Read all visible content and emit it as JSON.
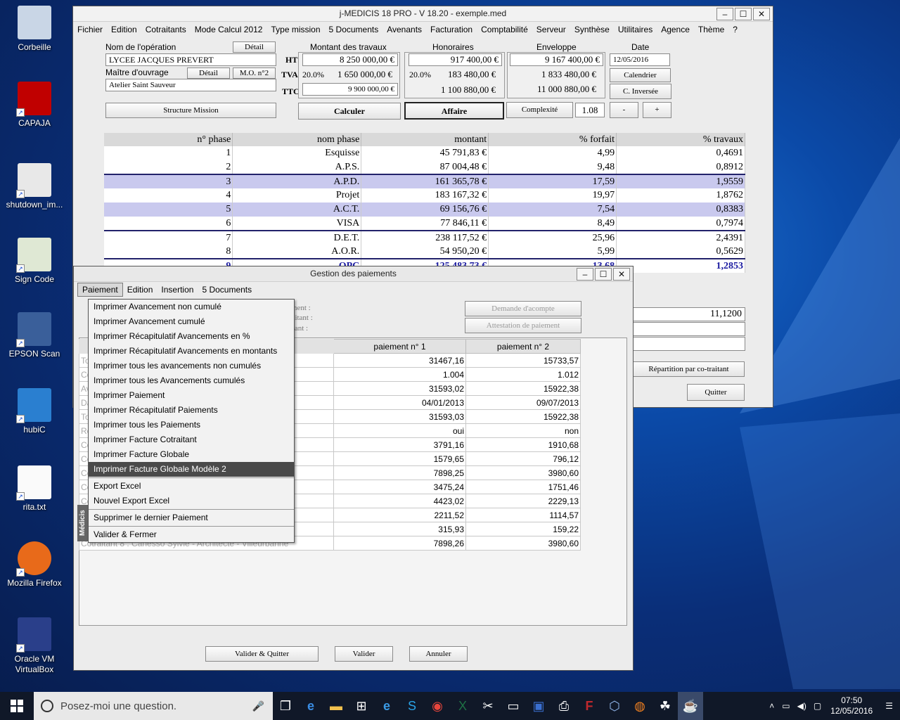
{
  "desktop": {
    "icons": [
      {
        "label": "Corbeille",
        "icon": "recycle-bin-icon"
      },
      {
        "label": "CAPAJA",
        "icon": "capaja-icon"
      },
      {
        "label": "shutdown_im...",
        "icon": "gear-file-icon"
      },
      {
        "label": "Sign Code",
        "icon": "certificate-icon"
      },
      {
        "label": "EPSON Scan",
        "icon": "scanner-icon"
      },
      {
        "label": "hubiC",
        "icon": "hubic-icon"
      },
      {
        "label": "rita.txt",
        "icon": "text-file-icon"
      },
      {
        "label": "Mozilla Firefox",
        "icon": "firefox-icon"
      },
      {
        "label": "Oracle VM VirtualBox",
        "icon": "virtualbox-icon"
      }
    ]
  },
  "main_window": {
    "title": "j-MEDICIS 18 PRO - V 18.20 - exemple.med",
    "menu": [
      "Fichier",
      "Edition",
      "Cotraitants",
      "Mode Calcul 2012",
      "Type mission",
      "5 Documents",
      "Avenants",
      "Facturation",
      "Comptabilité",
      "Serveur",
      "Synthèse",
      "Utilitaires",
      "Agence",
      "Thème",
      "?"
    ],
    "operation_label": "Nom de l'opération",
    "detail_label": "Détail",
    "operation_value": "LYCEE JACQUES PREVERT",
    "owner_label": "Maître d'ouvrage",
    "detail_label2": "Détail",
    "mo_label": "M.O. n°2",
    "owner_value": "Atelier Saint Sauveur",
    "ht": "HT",
    "tva": "TVA",
    "ttc": "TTC",
    "works_label": "Montant des travaux",
    "works_ht": "8 250 000,00 €",
    "works_tva_rate": "20.0%",
    "works_tva": "1 650 000,00 €",
    "works_ttc": "9 900 000,00 €",
    "fees_label": "Honoraires",
    "fees_ht": "917 400,00 €",
    "fees_tva_rate": "20.0%",
    "fees_tva": "183 480,00 €",
    "fees_ttc": "1 100 880,00 €",
    "envelope_label": "Enveloppe",
    "env_ht": "9 167 400,00 €",
    "env_tva": "1 833 480,00 €",
    "env_ttc": "11 000 880,00 €",
    "date_label": "Date",
    "date_value": "12/05/2016",
    "calendar_btn": "Calendrier",
    "reverse_btn": "C. Inversée",
    "structure_btn": "Structure Mission",
    "calc_btn": "Calculer",
    "affaire_btn": "Affaire",
    "complexity_btn": "Complexité",
    "complexity_value": "1.08",
    "minus_btn": "-",
    "plus_btn": "+",
    "phase_headers": [
      "n° phase",
      "nom phase",
      "montant",
      "% forfait",
      "% travaux"
    ],
    "phases": [
      {
        "n": "1",
        "name": "Esquisse",
        "amount": "45 791,83 €",
        "forfait": "4,99",
        "travaux": "0,4691"
      },
      {
        "n": "2",
        "name": "A.P.S.",
        "amount": "87 004,48 €",
        "forfait": "9,48",
        "travaux": "0,8912"
      },
      {
        "n": "3",
        "name": "A.P.D.",
        "amount": "161 365,78 €",
        "forfait": "17,59",
        "travaux": "1,9559"
      },
      {
        "n": "4",
        "name": "Projet",
        "amount": "183 167,32 €",
        "forfait": "19,97",
        "travaux": "1,8762"
      },
      {
        "n": "5",
        "name": "A.C.T.",
        "amount": "69 156,76 €",
        "forfait": "7,54",
        "travaux": "0,8383"
      },
      {
        "n": "6",
        "name": "VISA",
        "amount": "77 846,11 €",
        "forfait": "8,49",
        "travaux": "0,7974"
      },
      {
        "n": "7",
        "name": "D.E.T.",
        "amount": "238 117,52 €",
        "forfait": "25,96",
        "travaux": "2,4391"
      },
      {
        "n": "8",
        "name": "A.O.R.",
        "amount": "54 950,20 €",
        "forfait": "5,99",
        "travaux": "0,5629"
      },
      {
        "n": "9",
        "name": "OPC",
        "amount": "125 483,73 €",
        "forfait": "13,68",
        "travaux": "1,2853"
      }
    ],
    "side_value": "11,1200",
    "repartition_btn": "Répartition par co-traitant",
    "quit_btn": "Quitter"
  },
  "pay_window": {
    "title": "Gestion des paiements",
    "menu": [
      "Paiement",
      "Edition",
      "Insertion",
      "5 Documents"
    ],
    "info_paiement": "Paiement :",
    "info_cotraitant": "Cotraitant :",
    "info_montant": "Montant :",
    "acompte_btn": "Demande d'acompte",
    "attestation_btn": "Attestation de paiement",
    "col_headers": [
      "paiement n° 1",
      "paiement n° 2"
    ],
    "rows": [
      {
        "label": "Total Avancement",
        "p1": "31467,16",
        "p2": "15733,57"
      },
      {
        "label": "Coefficient",
        "p1": "1.004",
        "p2": "1.012"
      },
      {
        "label": "Avancement Révisé",
        "p1": "31593,02",
        "p2": "15922,38"
      },
      {
        "label": "Date",
        "p1": "04/01/2013",
        "p2": "09/07/2013"
      },
      {
        "label": "Total Paiement",
        "p1": "31593,03",
        "p2": "15922,38"
      },
      {
        "label": "Réglé",
        "p1": "oui",
        "p2": "non"
      },
      {
        "label": "Cotraitant 1 : Catane Hubert - Architecte - Grenoble",
        "p1": "3791,16",
        "p2": "1910,68"
      },
      {
        "label": "Cotraitant 2 : Lefèvre Paul - Economiste - Chambéry",
        "p1": "1579,65",
        "p2": "796,12"
      },
      {
        "label": "Cotraitant 3 : Morel Anne - BET - Grenoble",
        "p1": "7898,25",
        "p2": "3980,60"
      },
      {
        "label": "Cotraitant 4 : Simon Monique - Architecte - Lyon",
        "p1": "3475,24",
        "p2": "1751,46"
      },
      {
        "label": "Cotraitant 5 : Durand Louis - Architecte - Annecy",
        "p1": "4423,02",
        "p2": "2229,13"
      },
      {
        "label": "Cotraitant 6 : Blanc Pierre - Economiste - Valence",
        "p1": "2211,52",
        "p2": "1114,57"
      },
      {
        "label": "Cotraitant 7 : Ferrand Sophie - Economiste - Lyon",
        "p1": "315,93",
        "p2": "159,22"
      },
      {
        "label": "Cotraitant 8 : Carlesso Sylvie - Architecte - Villeurbanne",
        "p1": "7898,26",
        "p2": "3980,60"
      }
    ],
    "validate_quit_btn": "Valider & Quitter",
    "validate_btn": "Valider",
    "cancel_btn": "Annuler",
    "vertical_tab": "Médicis"
  },
  "dropdown": {
    "items": [
      "Imprimer Avancement non cumulé",
      "Imprimer Avancement cumulé",
      "Imprimer Récapitulatif Avancements en %",
      "Imprimer Récapitulatif Avancements en montants",
      "Imprimer tous les avancements non cumulés",
      "Imprimer tous les Avancements cumulés",
      "Imprimer Paiement",
      "Imprimer Récapitulatif Paiements",
      "Imprimer tous les Paiements",
      "Imprimer Facture Cotraitant",
      "Imprimer Facture Globale",
      "Imprimer Facture Globale Modèle 2",
      "Export Excel",
      "Nouvel Export Excel",
      "Supprimer le dernier Paiement",
      "Valider & Fermer"
    ],
    "active_index": 11
  },
  "taskbar": {
    "search_placeholder": "Posez-moi une question.",
    "time": "07:50",
    "date": "12/05/2016"
  }
}
